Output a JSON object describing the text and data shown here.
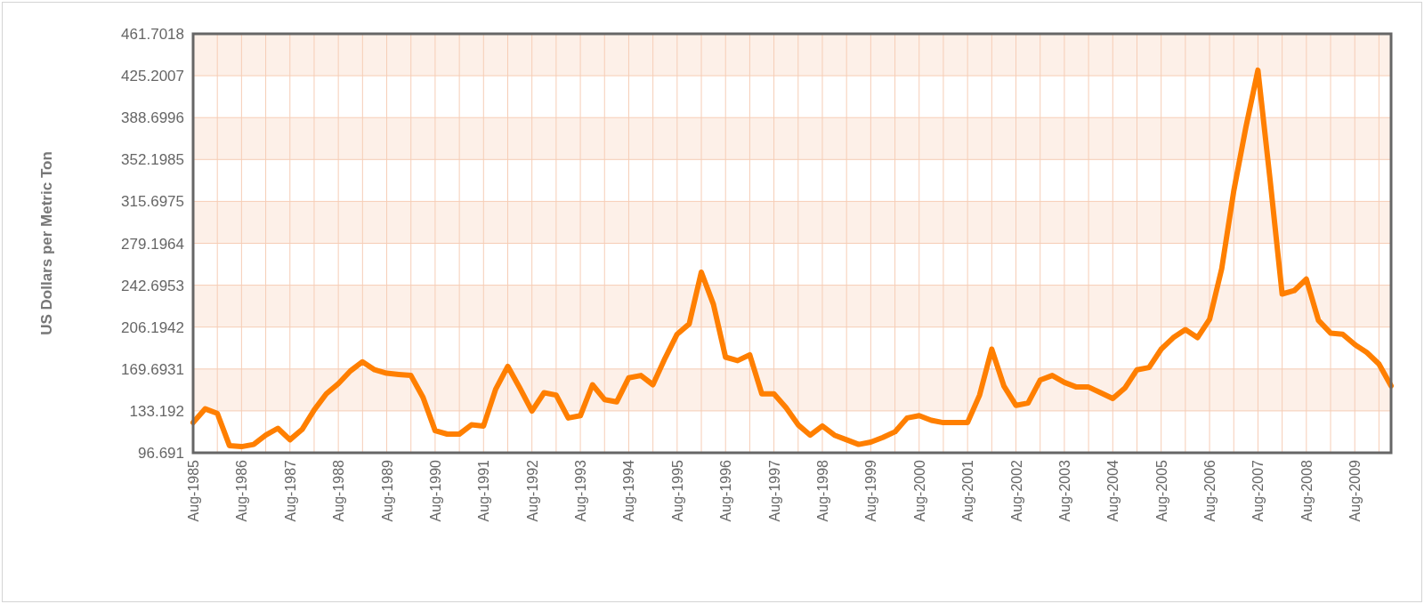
{
  "chart": {
    "chart_data": {
      "type": "line",
      "grid": true,
      "ylabel": "US Dollars per Metric Ton",
      "ylim": [
        96.691,
        461.7018
      ],
      "yticks": [
        {
          "value": 96.691,
          "label": "96.691"
        },
        {
          "value": 133.192,
          "label": "133.192"
        },
        {
          "value": 169.6931,
          "label": "169.6931"
        },
        {
          "value": 206.1942,
          "label": "206.1942"
        },
        {
          "value": 242.6953,
          "label": "242.6953"
        },
        {
          "value": 279.1964,
          "label": "279.1964"
        },
        {
          "value": 315.6975,
          "label": "315.6975"
        },
        {
          "value": 352.1985,
          "label": "352.1985"
        },
        {
          "value": 388.6996,
          "label": "388.6996"
        },
        {
          "value": 425.2007,
          "label": "425.2007"
        },
        {
          "value": 461.7018,
          "label": "461.7018"
        }
      ],
      "categories": [
        "Aug-1985",
        null,
        null,
        null,
        "Aug-1986",
        null,
        null,
        null,
        "Aug-1987",
        null,
        null,
        null,
        "Aug-1988",
        null,
        null,
        null,
        "Aug-1989",
        null,
        null,
        null,
        "Aug-1990",
        null,
        null,
        null,
        "Aug-1991",
        null,
        null,
        null,
        "Aug-1992",
        null,
        null,
        null,
        "Aug-1993",
        null,
        null,
        null,
        "Aug-1994",
        null,
        null,
        null,
        "Aug-1995",
        null,
        null,
        null,
        "Aug-1996",
        null,
        null,
        null,
        "Aug-1997",
        null,
        null,
        null,
        "Aug-1998",
        null,
        null,
        null,
        "Aug-1999",
        null,
        null,
        null,
        "Aug-2000",
        null,
        null,
        null,
        "Aug-2001",
        null,
        null,
        null,
        "Aug-2002",
        null,
        null,
        null,
        "Aug-2003",
        null,
        null,
        null,
        "Aug-2004",
        null,
        null,
        null,
        "Aug-2005",
        null,
        null,
        null,
        "Aug-2006",
        null,
        null,
        null,
        "Aug-2007",
        null,
        null,
        null,
        "Aug-2008",
        null,
        null,
        null,
        "Aug-2009",
        null,
        null,
        null
      ],
      "series": [
        {
          "color": "#ff7f00",
          "values": [
            123,
            135,
            131,
            103,
            102,
            104,
            112,
            118,
            108,
            117,
            134,
            148,
            157,
            168,
            176,
            169,
            166,
            165,
            164,
            145,
            116,
            113,
            113,
            121,
            120,
            152,
            172,
            153,
            133,
            149,
            147,
            127,
            129,
            156,
            143,
            141,
            162,
            164,
            156,
            179,
            200,
            209,
            254,
            226,
            180,
            177,
            182,
            148,
            148,
            136,
            121,
            112,
            120,
            112,
            108,
            104,
            106,
            110,
            115,
            127,
            129,
            125,
            123,
            123,
            123,
            147,
            187,
            155,
            138,
            140,
            160,
            164,
            158,
            154,
            154,
            149,
            144,
            153,
            169,
            171,
            187,
            197,
            204,
            197,
            213,
            257,
            325,
            380,
            430,
            335,
            235,
            238,
            248,
            212,
            201,
            200,
            191,
            184,
            174,
            155
          ]
        }
      ]
    }
  }
}
